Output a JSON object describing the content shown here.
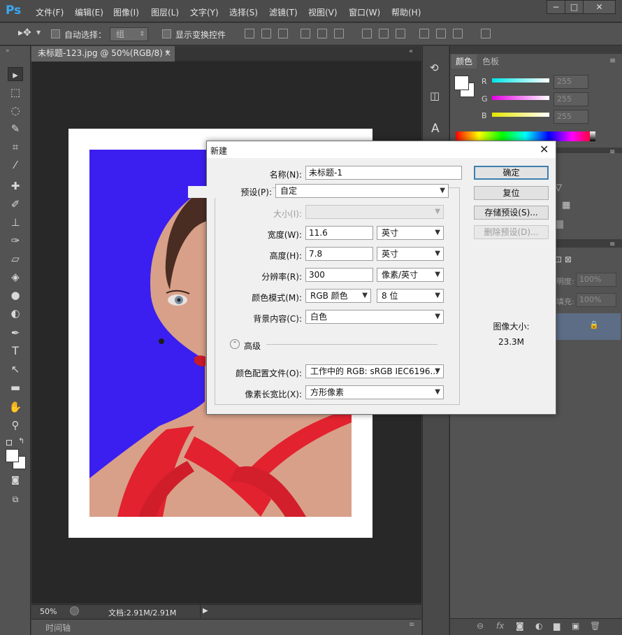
{
  "app": {
    "logo": "Ps"
  },
  "menu": [
    "文件(F)",
    "编辑(E)",
    "图像(I)",
    "图层(L)",
    "文字(Y)",
    "选择(S)",
    "滤镜(T)",
    "视图(V)",
    "窗口(W)",
    "帮助(H)"
  ],
  "options": {
    "auto_select_label": "自动选择：",
    "auto_select_value": "组",
    "show_transform_label": "显示变换控件"
  },
  "document": {
    "tab_title": "未标题-123.jpg @ 50%(RGB/8) *",
    "tab_close": "×"
  },
  "status": {
    "zoom": "50%",
    "doc_info": "文档:2.91M/2.91M"
  },
  "timeline": {
    "label": "时间轴"
  },
  "color_panel": {
    "tabs": [
      "颜色",
      "色板"
    ],
    "channels": [
      {
        "label": "R",
        "value": "255",
        "color": "#00e5e5"
      },
      {
        "label": "G",
        "value": "255",
        "color": "#e500e5"
      },
      {
        "label": "B",
        "value": "255",
        "color": "#e5e500"
      }
    ]
  },
  "layers_panel": {
    "opacity_label": "明度:",
    "opacity_value": "100%",
    "fill_label": "填充:",
    "fill_value": "100%"
  },
  "dialog": {
    "title": "新建",
    "name_label": "名称(N):",
    "name_value": "未标题-1",
    "preset_label": "预设(P):",
    "preset_value": "自定",
    "size_label": "大小(I):",
    "width_label": "宽度(W):",
    "width_value": "11.6",
    "width_unit": "英寸",
    "height_label": "高度(H):",
    "height_value": "7.8",
    "height_unit": "英寸",
    "resolution_label": "分辨率(R):",
    "resolution_value": "300",
    "resolution_unit": "像素/英寸",
    "color_mode_label": "颜色模式(M):",
    "color_mode_value": "RGB 颜色",
    "bit_depth": "8 位",
    "background_label": "背景内容(C):",
    "background_value": "白色",
    "advanced_label": "高级",
    "profile_label": "颜色配置文件(O):",
    "profile_value": "工作中的 RGB: sRGB IEC6196...",
    "aspect_label": "像素长宽比(X):",
    "aspect_value": "方形像素",
    "buttons": {
      "ok": "确定",
      "reset": "复位",
      "save_preset": "存储预设(S)...",
      "delete_preset": "删除预设(D)..."
    },
    "image_size_label": "图像大小:",
    "image_size_value": "23.3M"
  },
  "colors": {
    "accent_blue": "#3b1ef0",
    "dress_red": "#e3222f",
    "ok_border": "#3c7fb1"
  }
}
